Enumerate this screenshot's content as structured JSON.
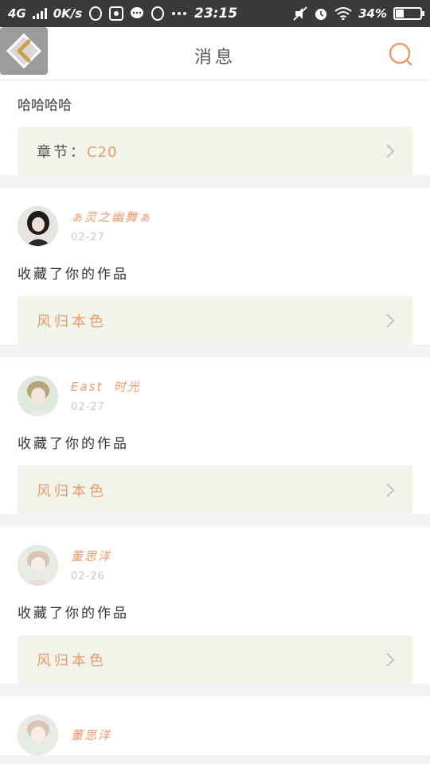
{
  "status_bar": {
    "network": "4G",
    "speed": "0K/s",
    "time": "23:15",
    "battery": "34%",
    "battery_level": 0.34,
    "left_icons": [
      "qq-icon",
      "app-icon",
      "message-icon",
      "qq-icon",
      "more-icon"
    ],
    "right_icons": [
      "mute-icon",
      "alarm-icon",
      "wifi-icon"
    ]
  },
  "header": {
    "title": "消息",
    "accent_color": "#e99a6a"
  },
  "top_item": {
    "text": "哈哈哈哈",
    "ref_label": "章节：",
    "ref_value": "C20"
  },
  "messages": [
    {
      "user": "ぁ灵之幽舞ぁ",
      "date": "02-27",
      "text": "收藏了你的作品",
      "work": "风归本色"
    },
    {
      "user": "East  时光",
      "date": "02-27",
      "text": "收藏了你的作品",
      "work": "风归本色"
    },
    {
      "user": "董思洋",
      "date": "02-26",
      "text": "收藏了你的作品",
      "work": "风归本色"
    },
    {
      "user": "董思洋"
    }
  ]
}
